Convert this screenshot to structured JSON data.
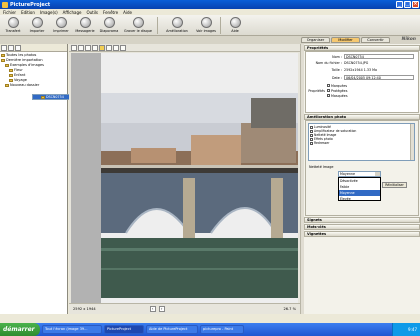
{
  "window": {
    "title": "PictureProject"
  },
  "menu": [
    "Fichier",
    "Edition",
    "Image(s)",
    "Affichage",
    "Outils",
    "Fenêtre",
    "Aide"
  ],
  "toolbar": [
    "Transfert",
    "Importer",
    "Imprimer",
    "Messagerie",
    "Diaporama",
    "Graver le disque",
    "Amélioration",
    "Voir images",
    "Aide"
  ],
  "tabs": [
    "Organiser",
    "Modifier",
    "Convertir"
  ],
  "brand": "Nikon",
  "tree": {
    "items": [
      "Toutes les photos",
      "Dernière importation",
      "Exemples d'images",
      "Fleur",
      "Enfant",
      "Voyage",
      "Nouveau dossier",
      "DSCN0754"
    ]
  },
  "viewer": {
    "dims": "2592 x 1944",
    "zoom": "26.7 %"
  },
  "properties": {
    "header": "Propriétés",
    "rows": [
      {
        "label": "Nom :",
        "value": "DSCN0754"
      },
      {
        "label": "Nom du fichier :",
        "value": "DSCN0754.JPG"
      },
      {
        "label": "Taille :",
        "value": "2592x1944   1.33 Mo"
      },
      {
        "label": "Date :",
        "value": "06/04/2005 09:12:40"
      }
    ],
    "keywords_label": "Propriétés",
    "keywords": [
      "Marquées",
      "Protégées",
      "Masquées"
    ]
  },
  "adjust": {
    "header": "Amélioration photo",
    "items": [
      "Luminosité",
      "Amplificateur de saturation",
      "Netteté Image",
      "Effets photo",
      "Redresser"
    ],
    "sharp_label": "Netteté Image",
    "selected": "Moyenne",
    "options": [
      "Désactivée",
      "Faible",
      "Moyenne",
      "Élevée"
    ],
    "highlight": "Moyenne",
    "reset": "Réinitialiser"
  },
  "panels": [
    "Signets",
    "Mots-clés",
    "Vignettes"
  ],
  "taskbar": {
    "start": "démarrer",
    "tasks": [
      "Tout l'écran (image 39...",
      "PictureProject",
      "Aide de PictureProject",
      "picturepro - Paint"
    ],
    "active": 1,
    "clock": "9:47"
  }
}
